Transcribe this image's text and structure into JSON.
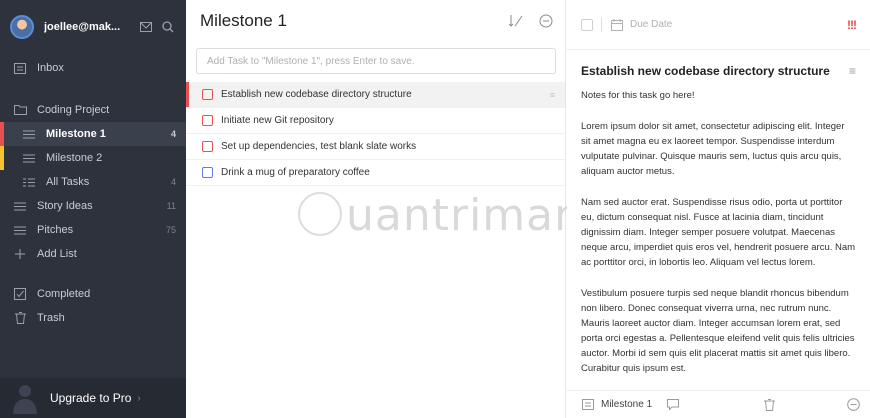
{
  "sidebar": {
    "user": "joellee@mak...",
    "items": {
      "inbox": {
        "label": "Inbox"
      },
      "coding_project": {
        "label": "Coding Project"
      },
      "milestone1": {
        "label": "Milestone 1",
        "count": "4"
      },
      "milestone2": {
        "label": "Milestone 2"
      },
      "all_tasks": {
        "label": "All Tasks",
        "count": "4"
      },
      "story_ideas": {
        "label": "Story Ideas",
        "count": "11"
      },
      "pitches": {
        "label": "Pitches",
        "count": "75"
      },
      "add_list": {
        "label": "Add List"
      },
      "completed": {
        "label": "Completed"
      },
      "trash": {
        "label": "Trash"
      }
    },
    "upgrade_label": "Upgrade to Pro"
  },
  "middle": {
    "title": "Milestone 1",
    "add_placeholder": "Add Task to \"Milestone 1\", press Enter to save.",
    "tasks": [
      {
        "label": "Establish new codebase directory structure"
      },
      {
        "label": "Initiate new Git repository"
      },
      {
        "label": "Set up dependencies, test blank slate works"
      },
      {
        "label": "Drink a mug of preparatory coffee"
      }
    ],
    "watermark": "uantrimang"
  },
  "detail": {
    "due_date": "Due Date",
    "title": "Establish new codebase directory structure",
    "note": "Notes for this task go here!",
    "paragraphs": [
      "Lorem ipsum dolor sit amet, consectetur adipiscing elit. Integer sit amet magna eu ex laoreet tempor. Suspendisse interdum vulputate pulvinar. Quisque mauris sem, luctus quis arcu quis, aliquam auctor metus.",
      "Nam sed auctor erat. Suspendisse risus odio, porta ut porttitor eu, dictum consequat nisl. Fusce at lacinia diam, tincidunt dignissim diam. Integer semper posuere volutpat. Maecenas neque arcu, imperdiet quis eros vel, hendrerit posuere arcu. Nam ac porttitor orci, in lobortis leo. Aliquam vel lectus lorem.",
      "Vestibulum posuere turpis sed neque blandit rhoncus bibendum non libero. Donec consequat viverra urna, nec rutrum nunc. Mauris laoreet auctor diam. Integer accumsan lorem erat, sed porta orci egestas a. Pellentesque eleifend velit quis felis ultricies auctor. Morbi id sem quis elit placerat mattis sit amet quis libero. Curabitur quis ipsum est."
    ],
    "footer_list": "Milestone 1"
  }
}
